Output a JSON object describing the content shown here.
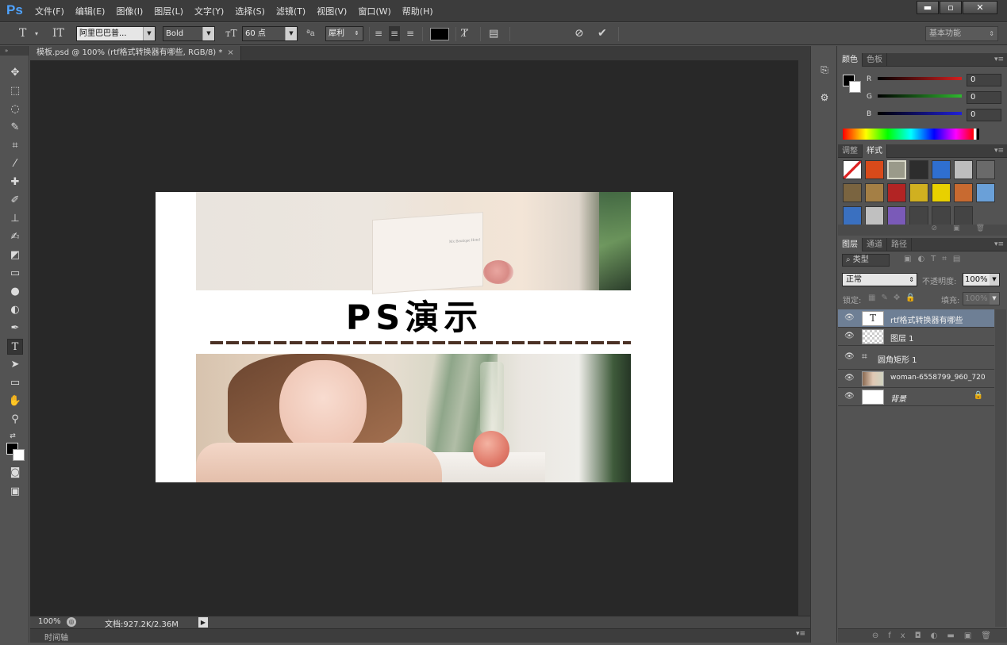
{
  "app": {
    "logo": "Ps"
  },
  "menu": [
    "文件(F)",
    "编辑(E)",
    "图像(I)",
    "图层(L)",
    "文字(Y)",
    "选择(S)",
    "滤镜(T)",
    "视图(V)",
    "窗口(W)",
    "帮助(H)"
  ],
  "window_controls": {
    "minimize": "▬",
    "restore": "▫",
    "close": "✕"
  },
  "options": {
    "font_family": "阿里巴巴普...",
    "font_style": "Bold",
    "font_size": "60 点",
    "aa_label": "ªa",
    "antialias": "犀利",
    "workspace": "基本功能"
  },
  "document": {
    "tab_label": "模板.psd @ 100% (rtf格式转换器有哪些, RGB/8) *",
    "title_text": "PS演示",
    "frame_text": "Mx Boutique Hotel"
  },
  "status": {
    "zoom": "100%",
    "doc_info": "文档:927.2K/2.36M"
  },
  "timeline_label": "时间轴",
  "color_panel": {
    "tabs": [
      "颜色",
      "色板"
    ],
    "channels": [
      {
        "label": "R",
        "value": "0",
        "color": "#d32020"
      },
      {
        "label": "G",
        "value": "0",
        "color": "#2eb82e"
      },
      {
        "label": "B",
        "value": "0",
        "color": "#2020d8"
      }
    ]
  },
  "styles_panel": {
    "tabs": [
      "调整",
      "样式"
    ],
    "swatches": [
      "#ffffff",
      "#d84a1a",
      "#9a9a8a",
      "#2d2d2d",
      "#2f6fd0",
      "#bdbdbd",
      "#6a6a6a",
      "#7a6440",
      "#a47f45",
      "#b22424",
      "#d0b020",
      "#e8d000",
      "#c86a30",
      "#6aa0d8",
      "#3a70c0",
      "#c0c0c0",
      "#7a5ab8",
      "#444444",
      "#444444",
      "#444444"
    ]
  },
  "layers_panel": {
    "tabs": [
      "图层",
      "通道",
      "路径"
    ],
    "filter": "类型",
    "blend_mode": "正常",
    "opacity_label": "不透明度:",
    "opacity": "100%",
    "lock_label": "锁定:",
    "fill_label": "填充:",
    "fill": "100%",
    "layers": [
      {
        "name": "rtf格式转换器有哪些",
        "kind": "text",
        "selected": true
      },
      {
        "name": "图层 1",
        "kind": "transparent",
        "selected": false
      },
      {
        "name": "圆角矩形 1",
        "kind": "shape",
        "selected": false
      },
      {
        "name": "woman-6558799_960_720",
        "kind": "image",
        "selected": false
      },
      {
        "name": "背景",
        "kind": "background",
        "selected": false
      }
    ]
  },
  "colors": {
    "accent": "#4fa3ff",
    "canvas_bg": "#282828",
    "selected_layer": "#6e7f95"
  }
}
